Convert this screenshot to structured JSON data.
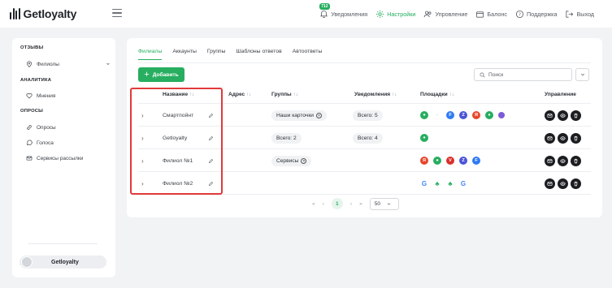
{
  "app": {
    "logo_text": "Getloyalty"
  },
  "topnav": {
    "badge": "712",
    "items": [
      {
        "label": "Уведомления",
        "icon": "bell-icon"
      },
      {
        "label": "Настройки",
        "icon": "gear-icon",
        "active": true
      },
      {
        "label": "Упровление",
        "icon": "users-icon"
      },
      {
        "label": "Бaлонс",
        "icon": "wallet-icon"
      },
      {
        "label": "Поддержка",
        "icon": "help-icon"
      },
      {
        "label": "Выход",
        "icon": "logout-icon"
      }
    ]
  },
  "sidebar": {
    "sections": [
      {
        "title": "ОТЗЫВЫ"
      },
      {
        "title": "АНАЛИТИКА"
      },
      {
        "title": "ОПРОСЫ"
      }
    ],
    "items": [
      {
        "label": "Филиолы",
        "icon": "location-icon"
      },
      {
        "label": "Мнения",
        "icon": "heart-icon"
      },
      {
        "label": "Опросы",
        "icon": "link-icon"
      },
      {
        "label": "Голоса",
        "icon": "chat-icon"
      },
      {
        "label": "Сервисы рассылки",
        "icon": "mail-icon"
      }
    ],
    "user": {
      "name": "Getloyalty"
    }
  },
  "tabs": [
    "Филиалы",
    "Аккаунты",
    "Группы",
    "Шаблоны ответов",
    "Автоответы"
  ],
  "toolbar": {
    "add_label": "Добавить",
    "search_placeholder": "Поиск"
  },
  "table": {
    "headers": {
      "name": "Название",
      "address": "Адрес",
      "groups": "Группы",
      "notifications": "Уведомления",
      "platforms": "Площадки",
      "manage": "Управление"
    },
    "sort_glyph": "↑↓",
    "rows": [
      {
        "name": "Смартпойнт",
        "groups": "Наши карточки",
        "notifications": "Всего: 5"
      },
      {
        "name": "Getloyalty",
        "groups": "Всего: 2",
        "notifications": "Всего: 4"
      },
      {
        "name": "Филиол №1",
        "groups": "Сервисы",
        "notifications": ""
      },
      {
        "name": "Филиол №2",
        "groups": "",
        "notifications": ""
      }
    ]
  },
  "pager": {
    "first": "«",
    "prev": "‹",
    "current": "1",
    "next": "›",
    "last": "»",
    "page_size": "50"
  },
  "colors": {
    "accent": "#27ae60",
    "highlight": "#e03a3a",
    "action_bg": "#1b1d21"
  }
}
